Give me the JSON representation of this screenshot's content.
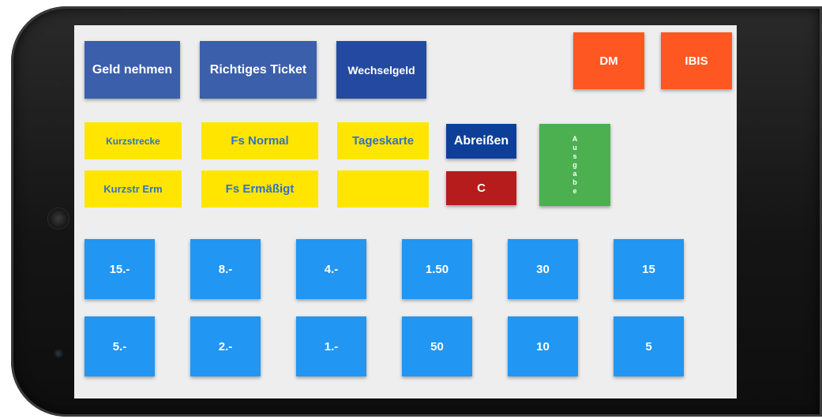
{
  "top_row": {
    "geld_nehmen": "Geld nehmen",
    "richtiges_ticket": "Richtiges Ticket",
    "wechselgeld": "Wechselgeld",
    "dm": "DM",
    "ibis": "IBIS"
  },
  "tickets": {
    "kurzstrecke": "Kurzstrecke",
    "fs_normal": "Fs Normal",
    "tageskarte": "Tageskarte",
    "kurzstr_erm": "Kurzstr Erm",
    "fs_ermaessigt": "Fs Ermäßigt",
    "empty": ""
  },
  "actions": {
    "abreissen": "Abreißen",
    "clear": "C",
    "ausgabe": [
      "A",
      "u",
      "s",
      "g",
      "a",
      "b",
      "e"
    ]
  },
  "amounts": {
    "row1": [
      "15.-",
      "8.-",
      "4.-",
      "1.50",
      "30",
      "15"
    ],
    "row2": [
      "5.-",
      "2.-",
      "1.-",
      "50",
      "10",
      "5"
    ]
  },
  "colors": {
    "screen_bg": "#eeeeee",
    "blue_button": "#3b5faa",
    "orange_button": "#ff5722",
    "yellow_button": "#ffe500",
    "yellow_text": "#2f74c4",
    "navy_button": "#0d3f99",
    "red_button": "#b71c1c",
    "green_button": "#4caf50",
    "amount_button": "#2196f3"
  }
}
